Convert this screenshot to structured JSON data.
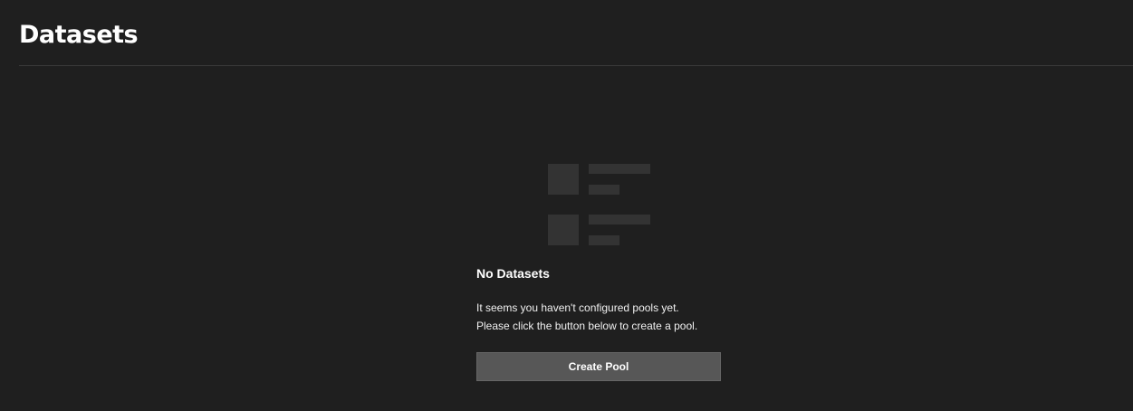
{
  "header": {
    "title": "Datasets"
  },
  "empty_state": {
    "icon": "empty-list-icon",
    "title": "No Datasets",
    "message_line1": "It seems you haven't configured pools yet.",
    "message_line2": "Please click the button below to create a pool.",
    "button_label": "Create Pool"
  },
  "colors": {
    "background": "#1f1f1f",
    "placeholder_shape": "#333333",
    "button_bg": "#575757",
    "divider": "#3a3a3a"
  }
}
